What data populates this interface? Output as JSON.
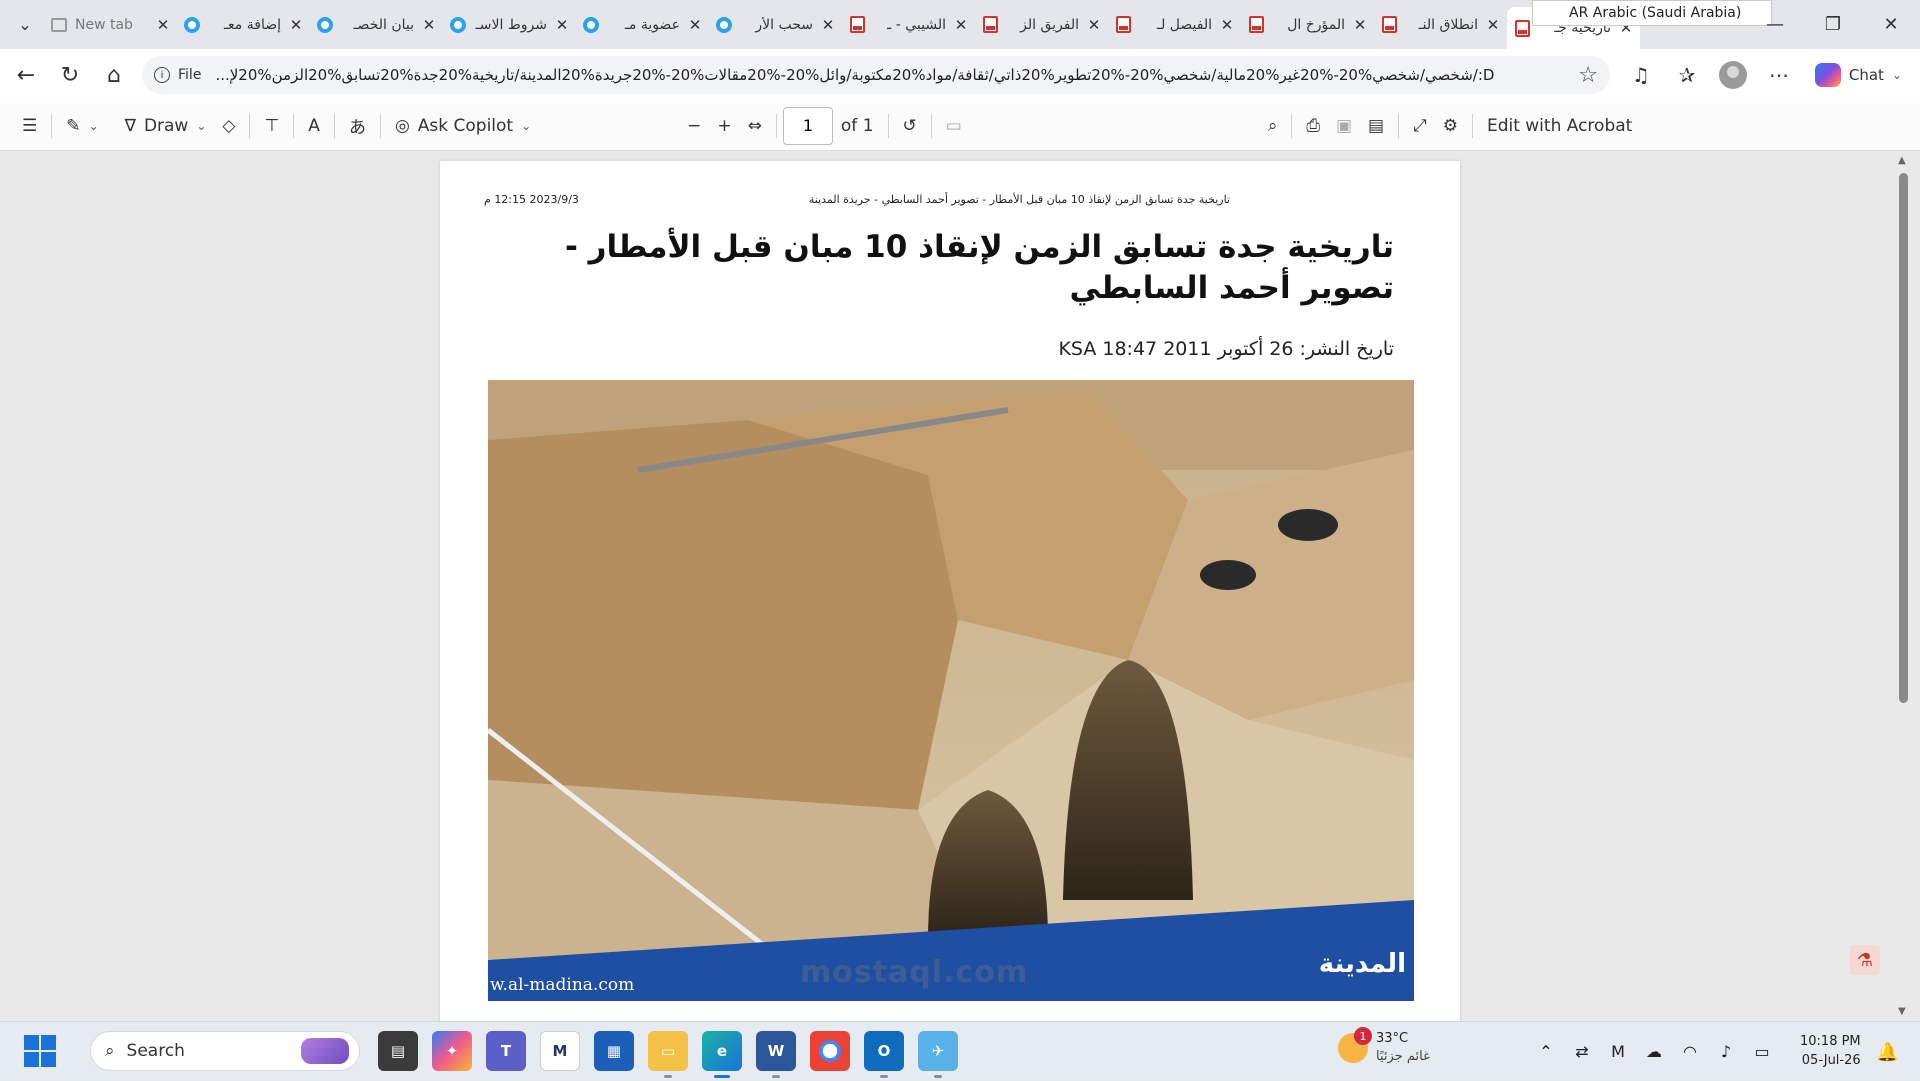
{
  "browser": {
    "tabs": [
      {
        "title": "New tab",
        "icon": "newtab-icon",
        "kind": "newtab"
      },
      {
        "title": "إضافة معـ",
        "icon": "globe-icon",
        "kind": "circle"
      },
      {
        "title": "بيان الخصـ",
        "icon": "globe-icon",
        "kind": "circle"
      },
      {
        "title": "شروط الاسـ",
        "icon": "globe-icon",
        "kind": "circle"
      },
      {
        "title": "عضوية مـ",
        "icon": "globe-icon",
        "kind": "circle"
      },
      {
        "title": "سحب الأر",
        "icon": "globe-icon",
        "kind": "circle"
      },
      {
        "title": "الشيبي - ـ",
        "icon": "pdf-icon",
        "kind": "pdf"
      },
      {
        "title": "الفريق الز",
        "icon": "pdf-icon",
        "kind": "pdf"
      },
      {
        "title": "الفيصل لـ",
        "icon": "pdf-icon",
        "kind": "pdf"
      },
      {
        "title": "المؤرخ ال",
        "icon": "pdf-icon",
        "kind": "pdf"
      },
      {
        "title": "انطلاق النـ",
        "icon": "pdf-icon",
        "kind": "pdf"
      },
      {
        "title": "تاريخية جـ",
        "icon": "pdf-icon",
        "kind": "pdf",
        "active": true
      }
    ],
    "language_popup": "AR Arabic (Saudi Arabia)",
    "address": {
      "scheme_label": "File",
      "url": "D:/شخصي/شخصي%20-%20غير%20مالية/شخصي%20-%20تطوير%20ذاتي/ثقافة/مواد%20مكتوبة/وائل%20-%20مقالات%20-%20جريدة%20المدينة/تاريخية%20جدة%20تسابق%20الزمن%20لإ..."
    },
    "chat_label": "Chat"
  },
  "pdf_toolbar": {
    "draw_label": "Draw",
    "ask_copilot_label": "Ask Copilot",
    "page_current": "1",
    "page_of": "of 1",
    "edit_acrobat_label": "Edit with Acrobat"
  },
  "document": {
    "header_date": "2023/9/3 12:15 م",
    "header_title": "تاريخية جدة تسابق الزمن لإنقاذ 10 مبان قبل الأمطار - تصوير أحمد السابطي - جريدة المدينة",
    "title": "تاريخية جدة تسابق الزمن لإنقاذ 10 مبان قبل الأمطار - تصوير أحمد السابطي",
    "pub_date": "تاريخ النشر: 26 أكتوبر 2011 18:47 KSA",
    "photo_caption": "w.al-madina.com",
    "photo_logo": "المدينة"
  },
  "watermark": "mostaql.com",
  "taskbar": {
    "search_placeholder": "Search",
    "weather": {
      "temp": "33°C",
      "condition": "غائم جزئيًا",
      "badge": "1"
    },
    "clock": {
      "time": "10:18 PM",
      "date": "05-Jul-26"
    }
  },
  "colors": {
    "accent": "#1a73d9",
    "pdf_red": "#d4332c",
    "tab_blue": "#2aa3e8"
  }
}
